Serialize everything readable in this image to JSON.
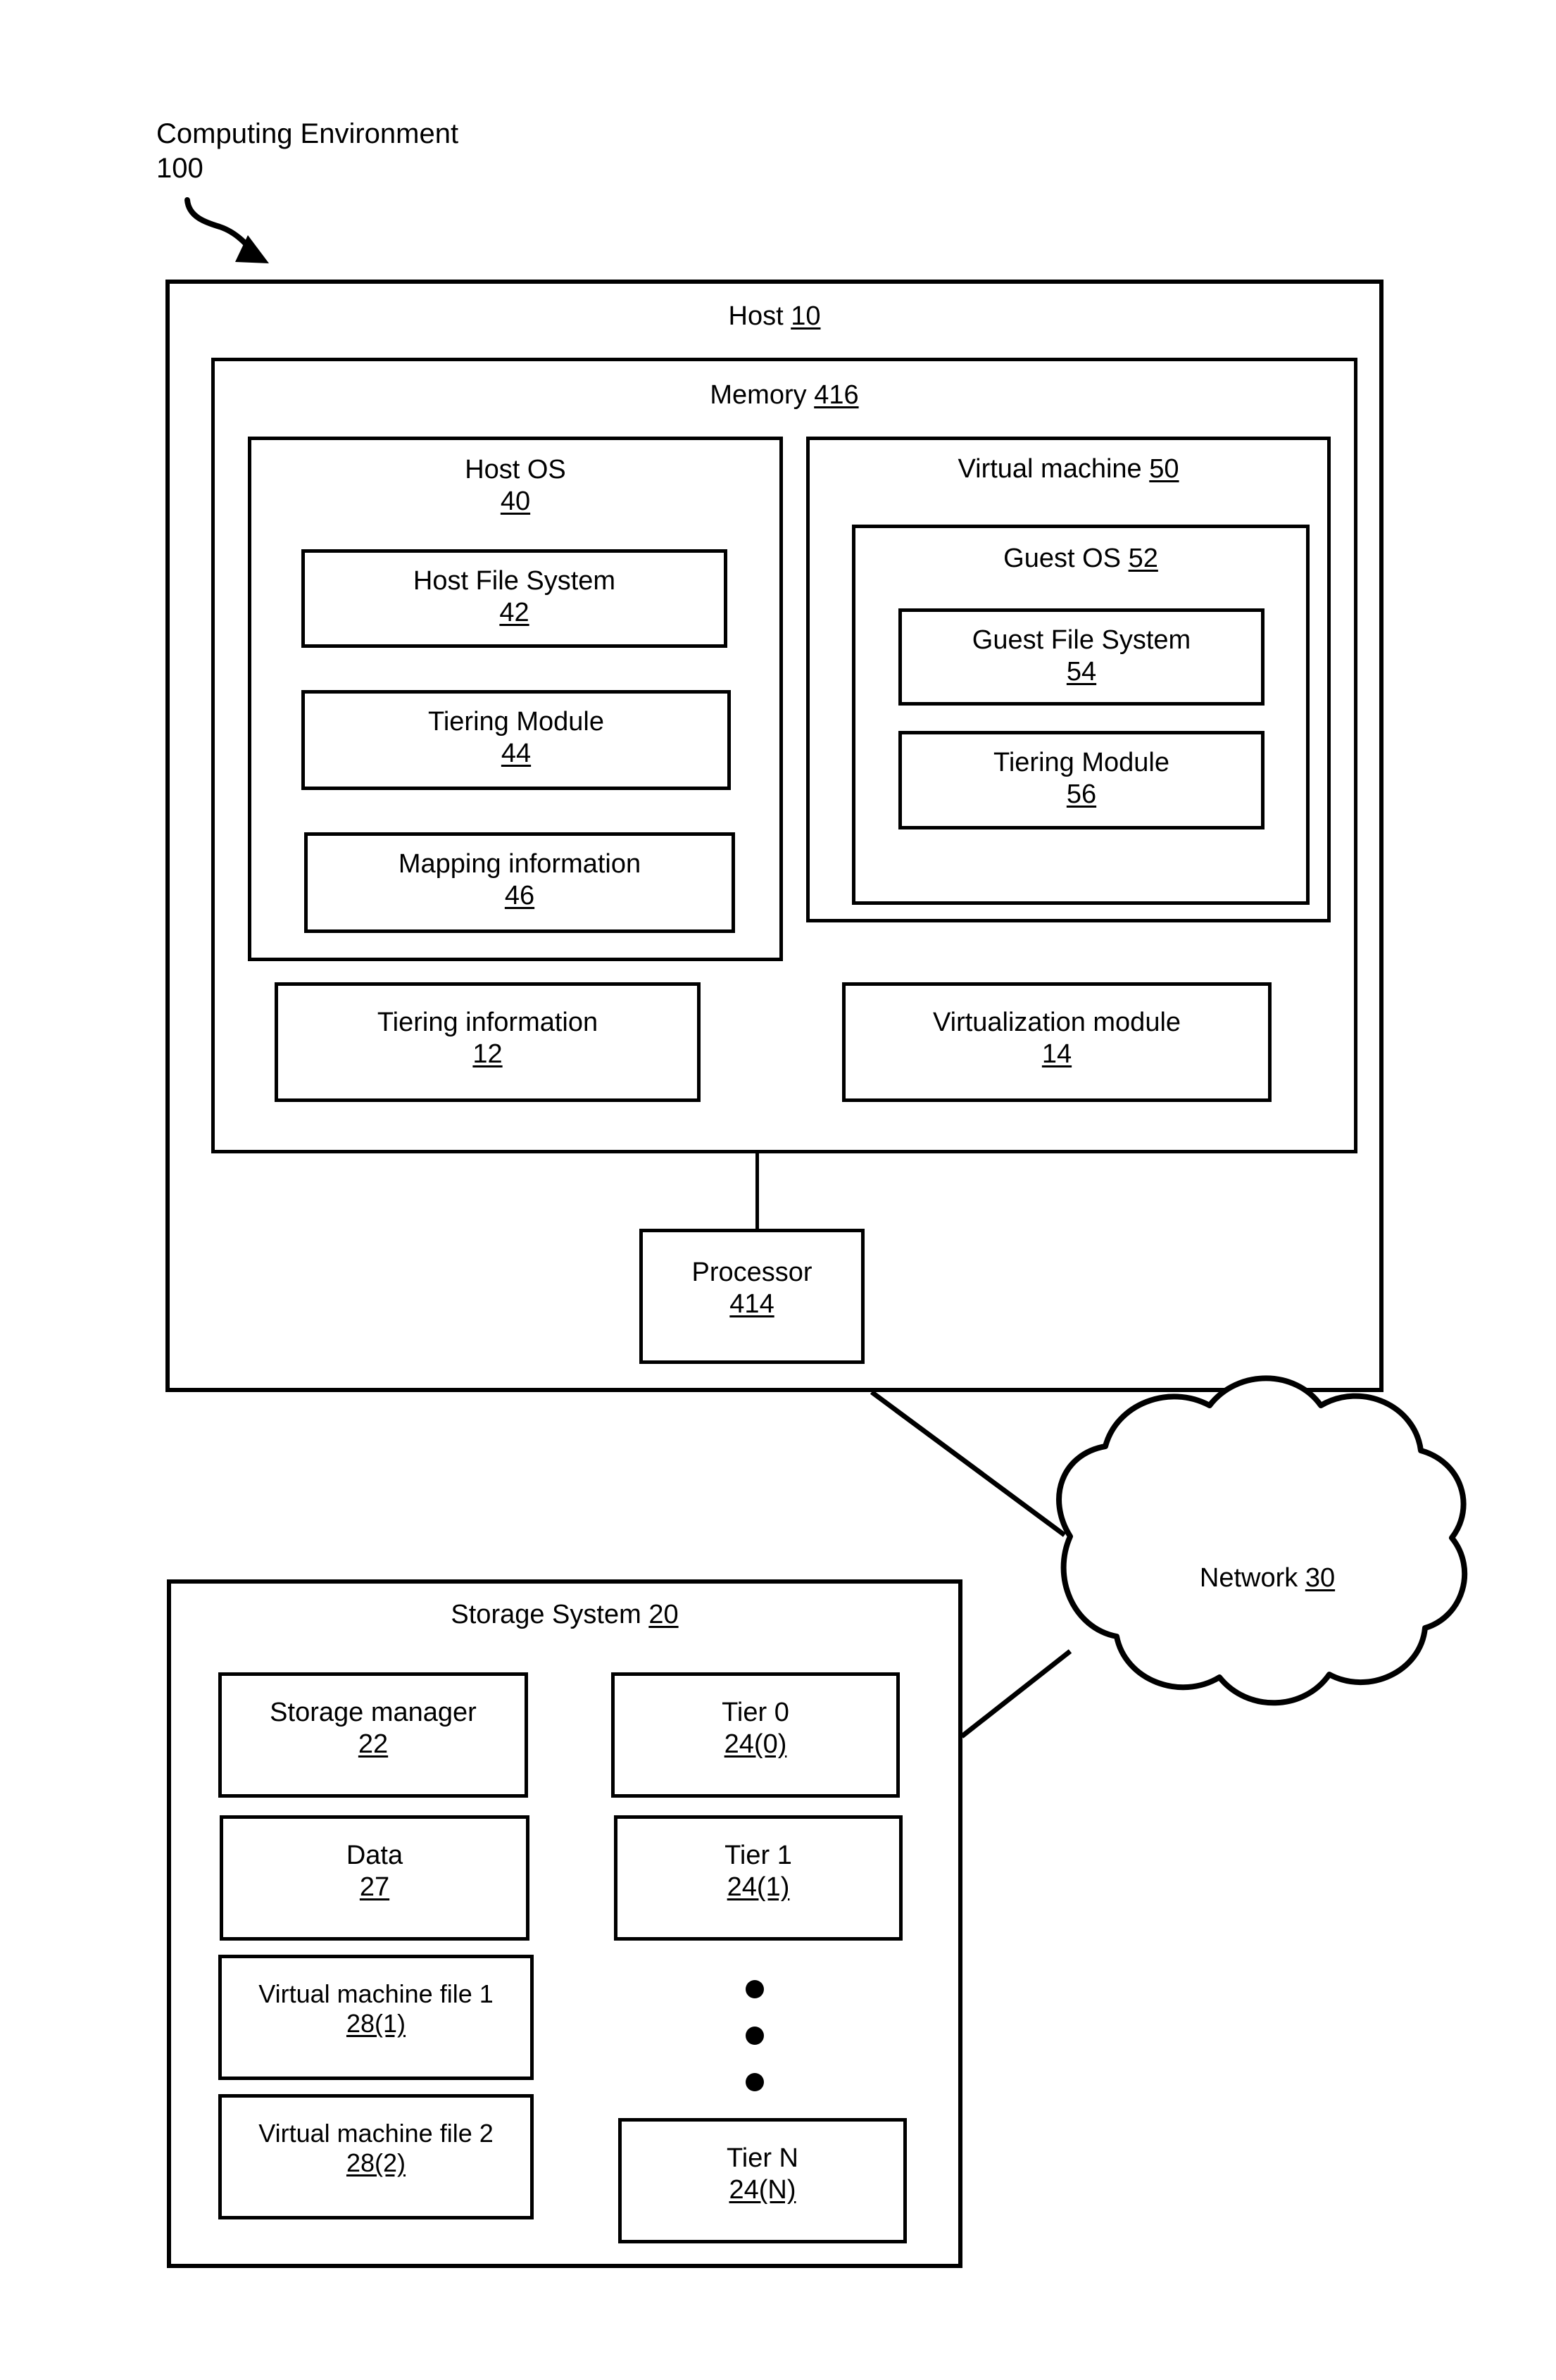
{
  "figure": {
    "callout": {
      "title": "Computing Environment",
      "ref": "100"
    }
  },
  "host": {
    "title": "Host",
    "ref": "10",
    "memory": {
      "title": "Memory",
      "ref": "416",
      "host_os": {
        "title": "Host OS",
        "ref": "40",
        "children": [
          {
            "title": "Host File System",
            "ref": "42"
          },
          {
            "title": "Tiering Module",
            "ref": "44"
          },
          {
            "title": "Mapping information",
            "ref": "46"
          }
        ]
      },
      "virtual_machine": {
        "title": "Virtual machine",
        "ref": "50",
        "guest_os": {
          "title": "Guest OS",
          "ref": "52",
          "children": [
            {
              "title": "Guest File System",
              "ref": "54"
            },
            {
              "title": "Tiering Module",
              "ref": "56"
            }
          ]
        }
      },
      "modules": [
        {
          "title": "Tiering information",
          "ref": "12"
        },
        {
          "title": "Virtualization module",
          "ref": "14"
        }
      ]
    },
    "processor": {
      "title": "Processor",
      "ref": "414"
    }
  },
  "network": {
    "title": "Network",
    "ref": "30"
  },
  "storage_system": {
    "title": "Storage System",
    "ref": "20",
    "left_column": [
      {
        "title": "Storage manager",
        "ref": "22"
      },
      {
        "title": "Data",
        "ref": "27"
      },
      {
        "title": "Virtual machine file 1",
        "ref": "28(1)"
      },
      {
        "title": "Virtual machine file 2",
        "ref": "28(2)"
      }
    ],
    "right_column": [
      {
        "title": "Tier 0",
        "ref": "24(0)"
      },
      {
        "title": "Tier 1",
        "ref": "24(1)"
      },
      {
        "title": "Tier N",
        "ref": "24(N)"
      }
    ],
    "ellipsis": "vertical-dots"
  },
  "colors": {
    "ink": "#000000",
    "paper": "#ffffff"
  }
}
